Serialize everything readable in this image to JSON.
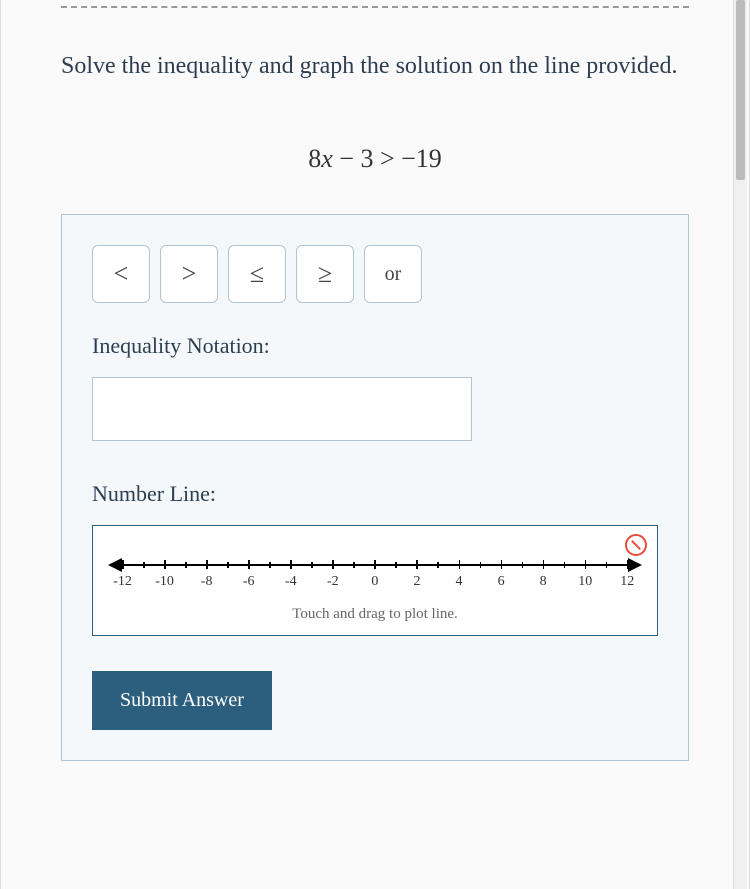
{
  "question": "Solve the inequality and graph the solution on the line provided.",
  "equation": {
    "lhs_coef": "8",
    "lhs_var": "x",
    "lhs_op": "−",
    "lhs_const": "3",
    "comparator": ">",
    "rhs": "−19"
  },
  "operators": {
    "lt": "<",
    "gt": ">",
    "le": "≤",
    "ge": "≥",
    "or": "or"
  },
  "labels": {
    "inequality": "Inequality Notation:",
    "numberline": "Number Line:",
    "hint": "Touch and drag to plot line.",
    "submit": "Submit Answer"
  },
  "numberline": {
    "ticks": [
      "-12",
      "-10",
      "-8",
      "-6",
      "-4",
      "-2",
      "0",
      "2",
      "4",
      "6",
      "8",
      "10",
      "12"
    ]
  },
  "answer_value": ""
}
